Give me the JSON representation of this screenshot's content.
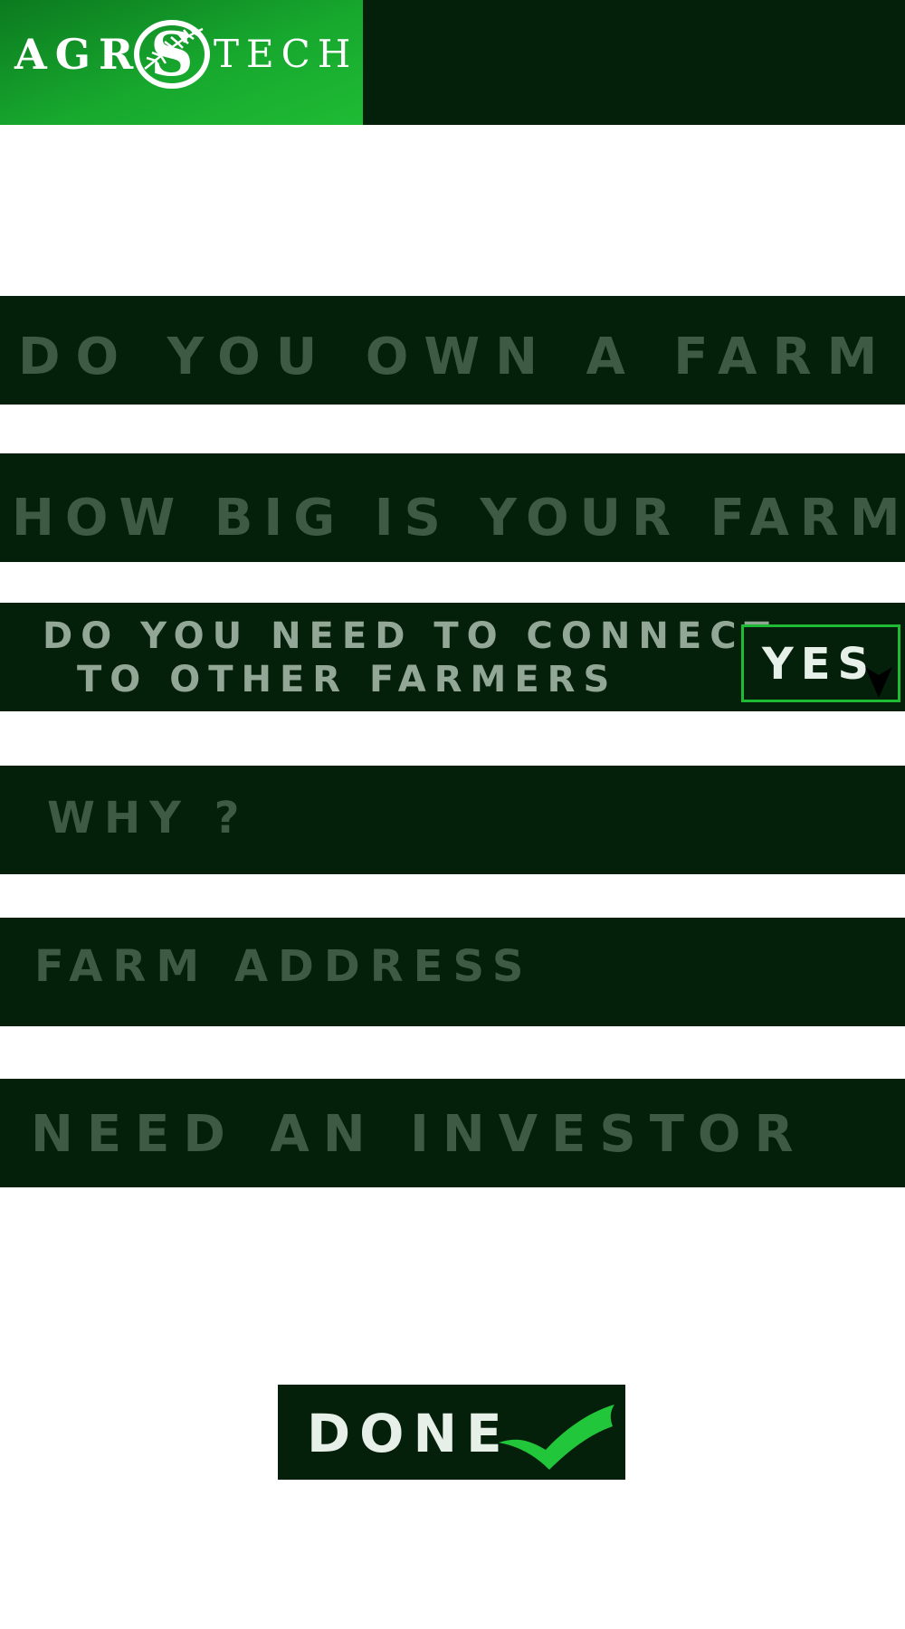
{
  "header": {
    "logo": {
      "text_left": "AGR",
      "text_emblem": "S",
      "text_right": "TECH",
      "emblem_icon": "fern-leaf-icon"
    }
  },
  "form": {
    "fields": [
      {
        "label": "DO YOU OWN A FARM"
      },
      {
        "label": "HOW BIG IS YOUR FARM"
      },
      {
        "label_line1": "DO YOU NEED TO CONNECT",
        "label_line2": "TO OTHER FARMERS",
        "value": "YES"
      },
      {
        "label": "WHY ?"
      },
      {
        "label": "FARM ADDRESS"
      },
      {
        "label": "NEED AN INVESTOR"
      }
    ],
    "done_label": "DONE",
    "select_arrow_icon": "arrow-down-icon",
    "done_icon": "check-icon"
  },
  "colors": {
    "dark_green": "#04200a",
    "brand_green": "#1fbb34",
    "label_dim": "#3f5a44",
    "label_light": "#93a797",
    "text_light": "#e6f0e8"
  }
}
